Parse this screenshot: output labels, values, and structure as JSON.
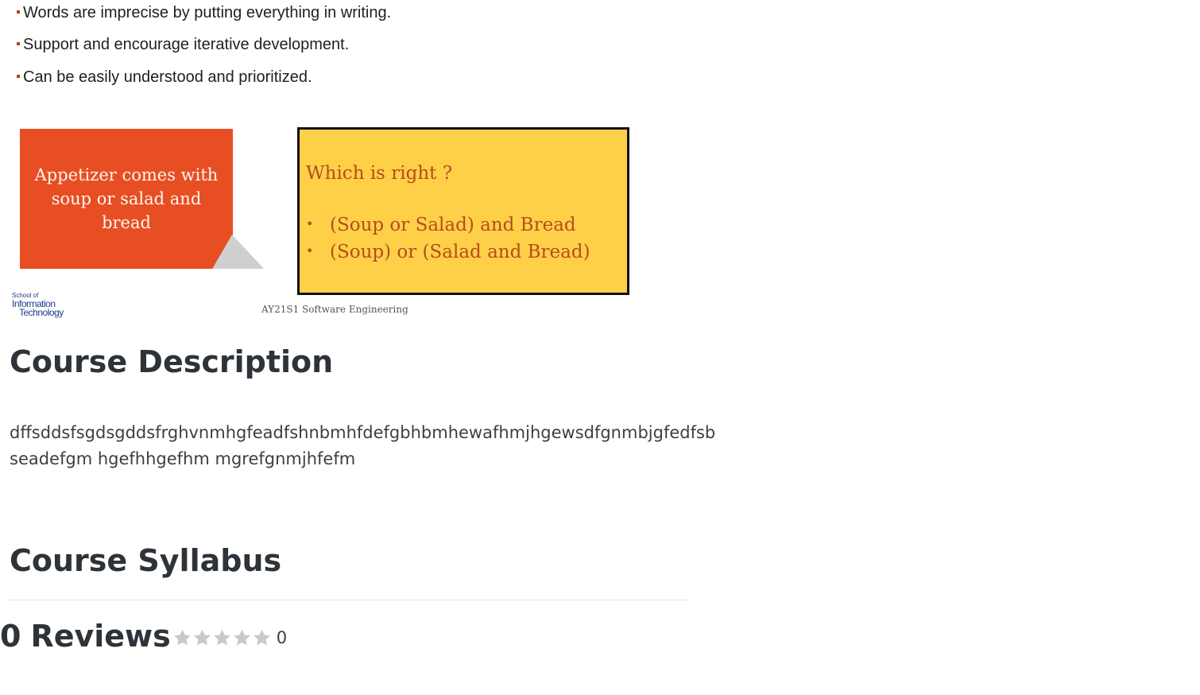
{
  "slide": {
    "bullets": [
      "Words are imprecise by putting everything in writing.",
      "Support and encourage iterative development.",
      "Can be easily understood and prioritized."
    ],
    "orange_box_text": "Appetizer comes with soup or salad and bread",
    "yellow_box": {
      "title": "Which is right ?",
      "options": [
        "(Soup or Salad) and Bread",
        "(Soup) or (Salad and Bread)"
      ]
    },
    "logo": {
      "line1": "School of",
      "line2": "Information",
      "line3": "Technology"
    },
    "footer_caption": "AY21S1 Software Engineering"
  },
  "course_description": {
    "heading": "Course Description",
    "lines": [
      "dffsddsfsgdsgddsfrghvnmhgfeadfshnbmhfdefgbhbmhewafhmjhgewsdfgnmbjgfedfsb",
      "seadefgm hgefhhgefhm mgrefgnmjhfefm"
    ]
  },
  "course_syllabus": {
    "heading": "Course Syllabus"
  },
  "reviews": {
    "count_prefix": "0",
    "label": "Reviews",
    "rating_count": "0",
    "stars_filled": 0,
    "stars_total": 5,
    "star_color": "#c9c9c9"
  }
}
